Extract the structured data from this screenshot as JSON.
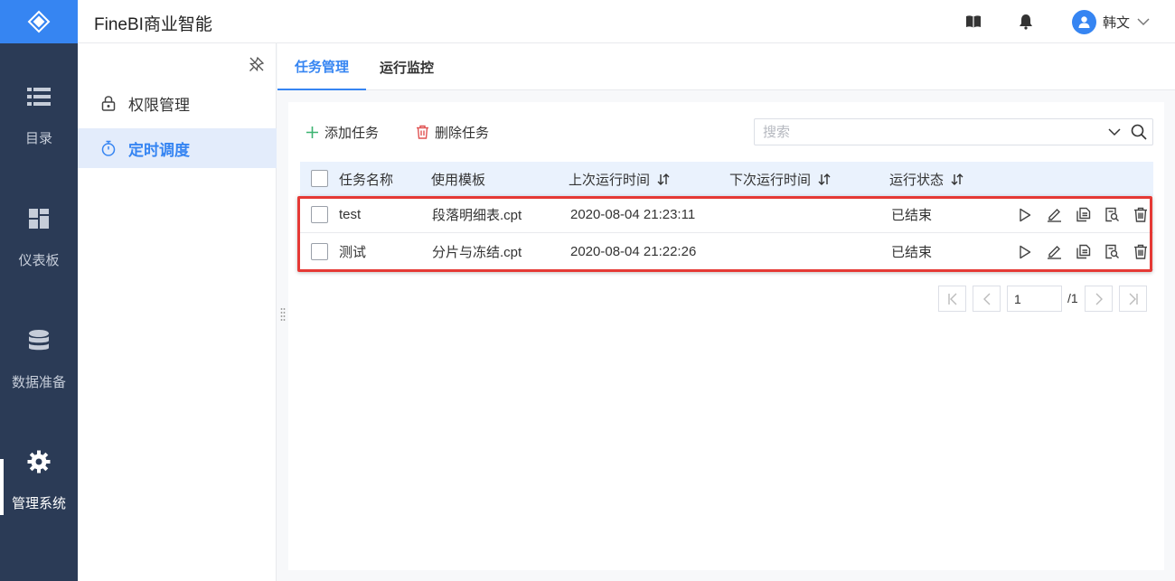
{
  "app": {
    "title": "FineBI商业智能"
  },
  "header": {
    "user_name": "韩文",
    "icons": [
      "book-icon",
      "bell-icon",
      "user-avatar-icon",
      "chevron-down-icon"
    ]
  },
  "leftnav": {
    "items": [
      {
        "label": "目录",
        "icon": "list-icon"
      },
      {
        "label": "仪表板",
        "icon": "dashboard-icon"
      },
      {
        "label": "数据准备",
        "icon": "database-icon"
      },
      {
        "label": "管理系统",
        "icon": "gear-icon",
        "active": true
      }
    ]
  },
  "subnav": {
    "items": [
      {
        "label": "权限管理",
        "icon": "lock-icon"
      },
      {
        "label": "定时调度",
        "icon": "timer-icon",
        "active": true
      }
    ]
  },
  "tabs": [
    {
      "label": "任务管理",
      "active": true
    },
    {
      "label": "运行监控"
    }
  ],
  "toolbar": {
    "add_label": "添加任务",
    "delete_label": "删除任务",
    "search_placeholder": "搜索"
  },
  "table": {
    "headers": [
      "任务名称",
      "使用模板",
      "上次运行时间",
      "下次运行时间",
      "运行状态"
    ],
    "rows": [
      {
        "name": "test",
        "template": "段落明细表.cpt",
        "last_run": "2020-08-04 21:23:11",
        "next_run": "",
        "status": "已结束"
      },
      {
        "name": "测试",
        "template": "分片与冻结.cpt",
        "last_run": "2020-08-04 21:22:26",
        "next_run": "",
        "status": "已结束"
      }
    ],
    "row_actions": [
      "play-icon",
      "edit-icon",
      "copy-icon",
      "preview-icon",
      "trash-icon"
    ]
  },
  "pagination": {
    "current": "1",
    "total": "/1"
  },
  "colors": {
    "accent": "#3685f2",
    "nav_bg": "#2b3b56",
    "highlight": "#e53935",
    "add": "#3cb371",
    "delete": "#e05252"
  }
}
